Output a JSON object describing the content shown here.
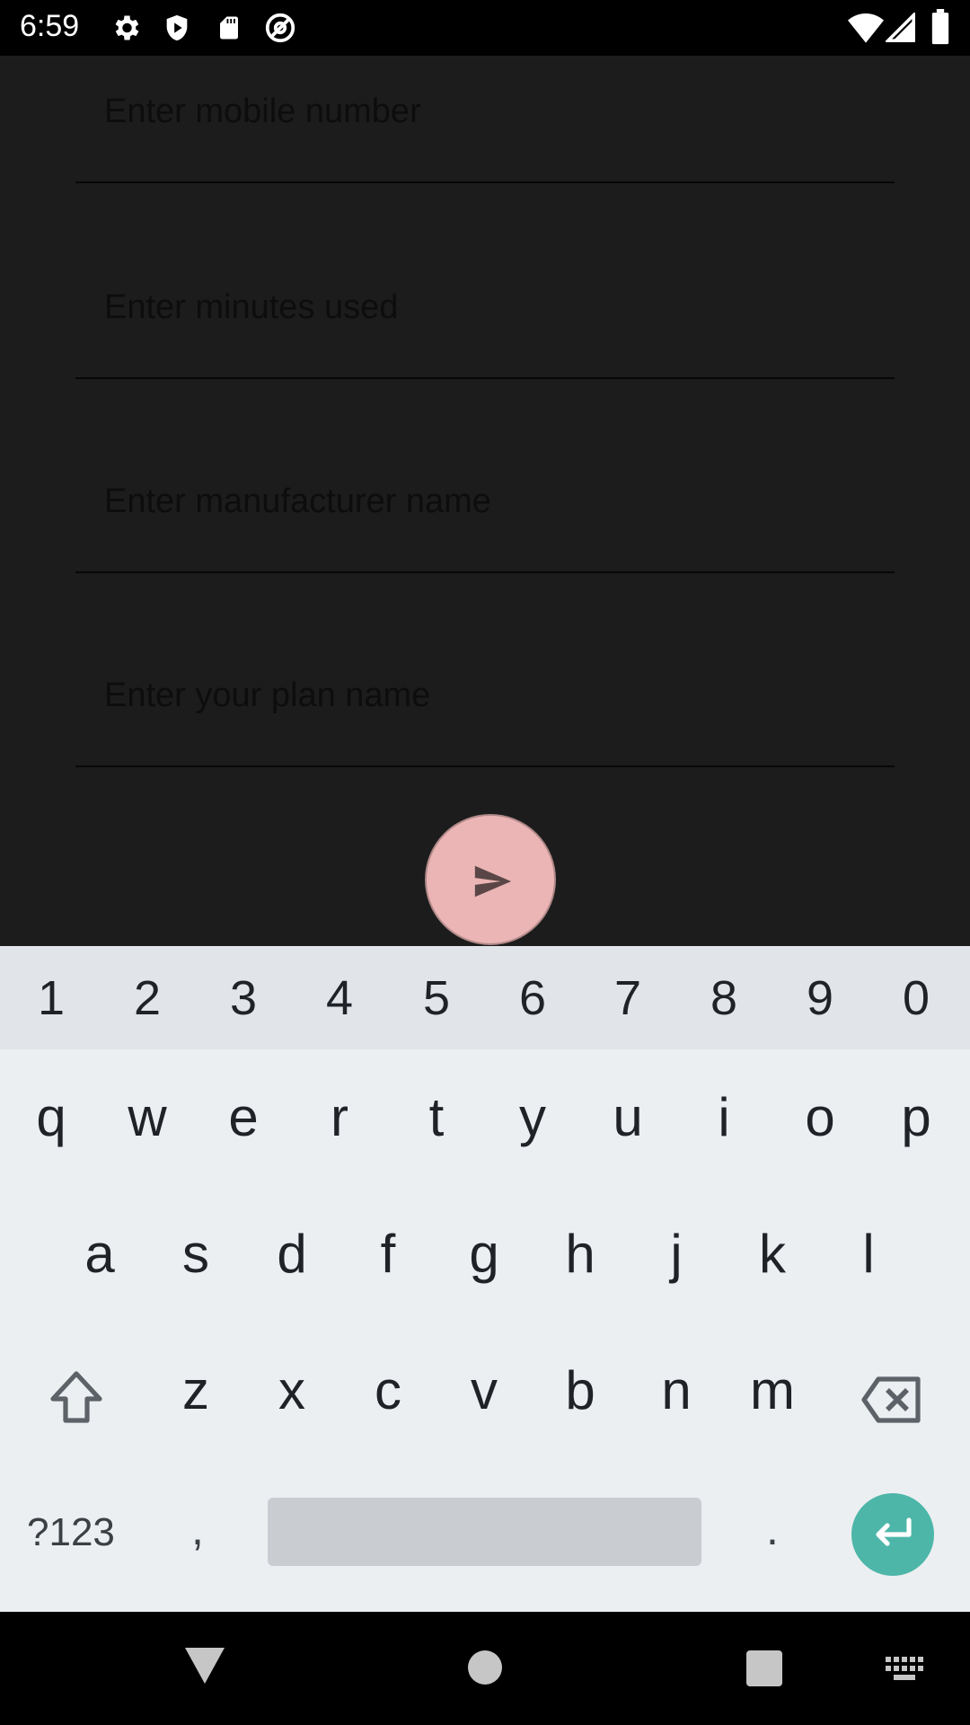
{
  "status_bar": {
    "time": "6:59",
    "left_icons": [
      "settings-icon",
      "shield-play-icon",
      "sd-card-icon",
      "at-sign-icon"
    ],
    "right_icons": [
      "wifi-icon",
      "cellular-signal-icon",
      "battery-icon"
    ]
  },
  "form": {
    "fields": [
      {
        "name": "mobile-number-field",
        "placeholder": "Enter mobile number",
        "value": ""
      },
      {
        "name": "minutes-used-field",
        "placeholder": "Enter minutes used",
        "value": ""
      },
      {
        "name": "manufacturer-name-field",
        "placeholder": "Enter manufacturer name",
        "value": ""
      },
      {
        "name": "plan-name-field",
        "placeholder": "Enter your plan name",
        "value": ""
      }
    ],
    "submit_icon": "send-icon",
    "fab_color": "#ebb5b5"
  },
  "keyboard": {
    "number_row": [
      "1",
      "2",
      "3",
      "4",
      "5",
      "6",
      "7",
      "8",
      "9",
      "0"
    ],
    "row1": [
      "q",
      "w",
      "e",
      "r",
      "t",
      "y",
      "u",
      "i",
      "o",
      "p"
    ],
    "row2": [
      "a",
      "s",
      "d",
      "f",
      "g",
      "h",
      "j",
      "k",
      "l"
    ],
    "row3": [
      "z",
      "x",
      "c",
      "v",
      "b",
      "n",
      "m"
    ],
    "symbols_label": "?123",
    "comma": ",",
    "period": ".",
    "shift_icon": "shift-icon",
    "backspace_icon": "backspace-icon",
    "enter_icon": "enter-icon",
    "enter_color": "#4db6a9"
  },
  "nav_bar": {
    "icons": [
      "back-icon",
      "home-icon",
      "recents-icon",
      "keyboard-switch-icon"
    ]
  }
}
